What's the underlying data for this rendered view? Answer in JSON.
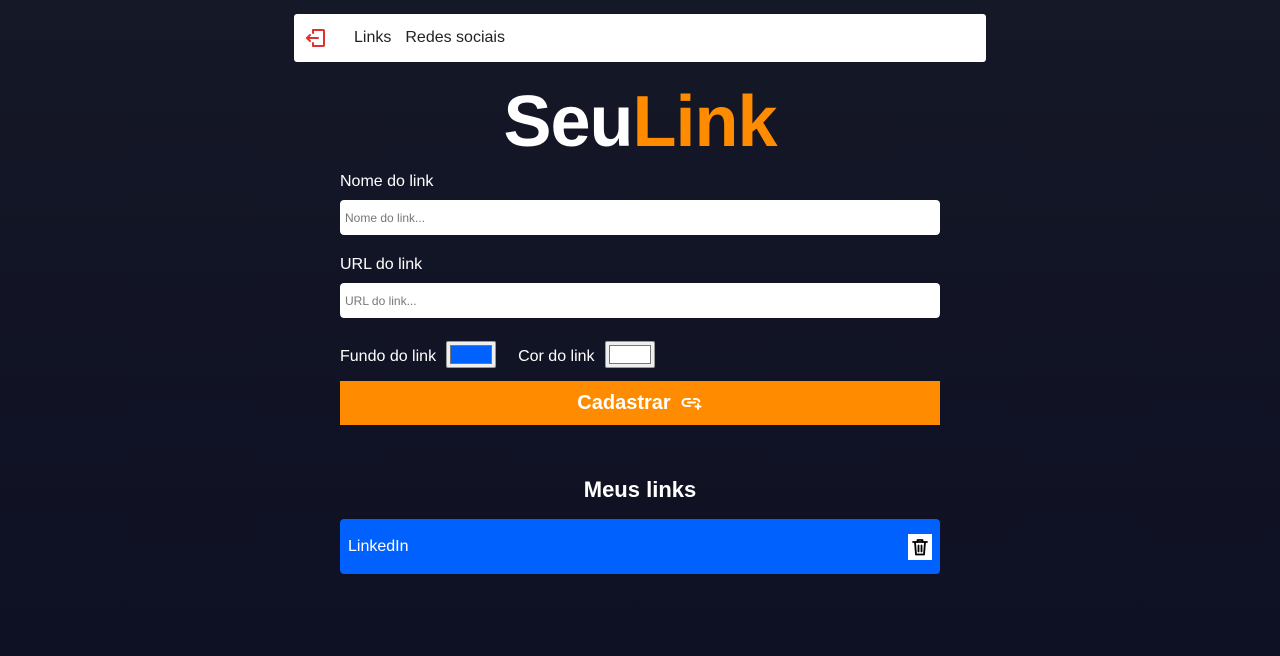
{
  "header": {
    "logout_icon": "logout-icon",
    "nav": [
      {
        "label": "Links"
      },
      {
        "label": "Redes sociais"
      }
    ]
  },
  "logo": {
    "part1": "Seu",
    "part2": "Link"
  },
  "form": {
    "name_label": "Nome do link",
    "name_placeholder": "Nome do link...",
    "name_value": "",
    "url_label": "URL do link",
    "url_placeholder": "URL do link...",
    "url_value": "",
    "bg_label": "Fundo do link",
    "bg_color": "#0061ff",
    "text_label": "Cor do link",
    "text_color": "#ffffff",
    "submit_label": "Cadastrar",
    "submit_icon": "link-add-icon"
  },
  "links_section": {
    "title": "Meus links",
    "items": [
      {
        "label": "LinkedIn",
        "bg": "#0061ff",
        "color": "#ffffff",
        "delete_icon": "trash-icon"
      }
    ]
  },
  "colors": {
    "accent": "#ff8c00",
    "logout_icon": "#e03131"
  }
}
